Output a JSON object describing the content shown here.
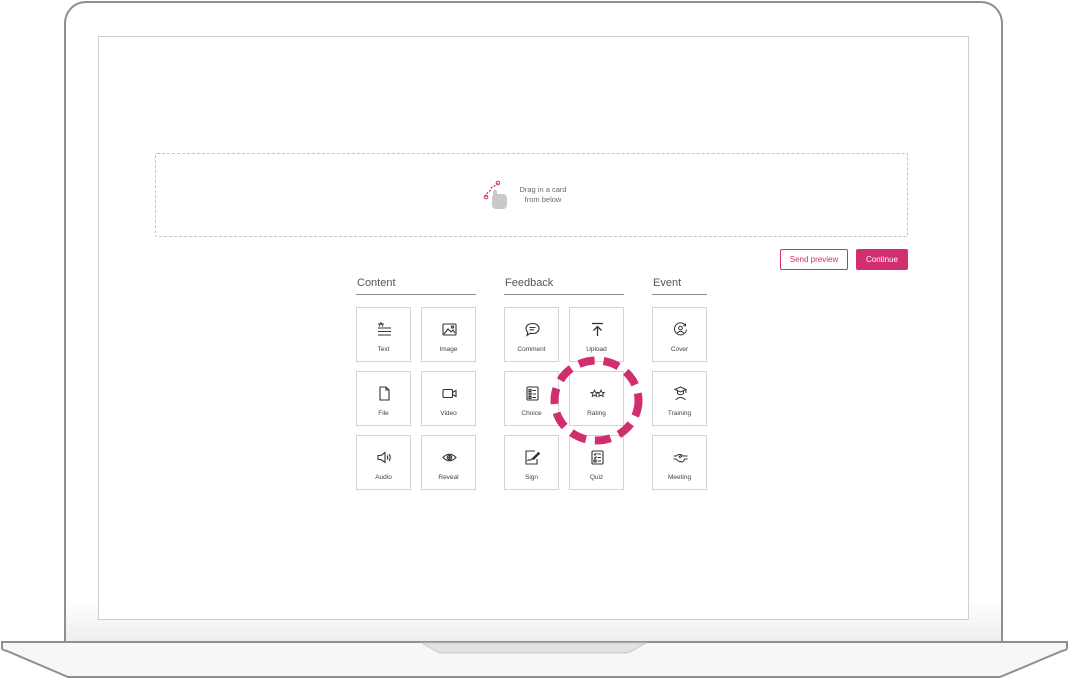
{
  "drop_zone": {
    "line1": "Drag in a card",
    "line2": "from below"
  },
  "actions": {
    "send_preview": "Send preview",
    "continue": "Continue"
  },
  "accent_color": "#d02e6e",
  "sections": {
    "content": {
      "title": "Content",
      "cards": [
        {
          "label": "Text",
          "icon": "text-icon"
        },
        {
          "label": "Image",
          "icon": "image-icon"
        },
        {
          "label": "File",
          "icon": "file-icon"
        },
        {
          "label": "Video",
          "icon": "video-icon"
        },
        {
          "label": "Audio",
          "icon": "audio-icon"
        },
        {
          "label": "Reveal",
          "icon": "eye-icon"
        }
      ]
    },
    "feedback": {
      "title": "Feedback",
      "cards": [
        {
          "label": "Comment",
          "icon": "comment-icon"
        },
        {
          "label": "Upload",
          "icon": "upload-icon"
        },
        {
          "label": "Choice",
          "icon": "checklist-icon"
        },
        {
          "label": "Rating",
          "icon": "stars-icon"
        },
        {
          "label": "Sign",
          "icon": "signature-icon"
        },
        {
          "label": "Quiz",
          "icon": "quiz-icon"
        }
      ]
    },
    "event": {
      "title": "Event",
      "cards": [
        {
          "label": "Cover",
          "icon": "cover-icon"
        },
        {
          "label": "Training",
          "icon": "training-icon"
        },
        {
          "label": "Meeting",
          "icon": "handshake-icon"
        }
      ]
    }
  }
}
